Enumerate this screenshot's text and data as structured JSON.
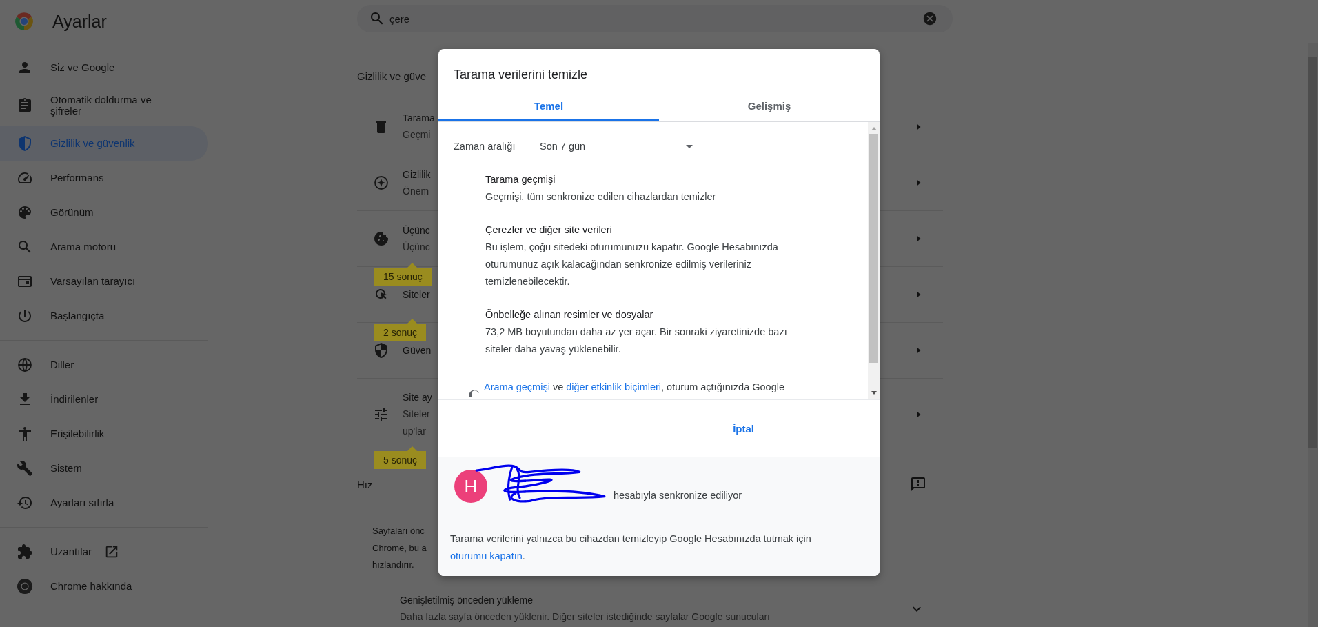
{
  "header": {
    "title": "Ayarlar",
    "search": {
      "value": "çere"
    }
  },
  "sidebar": {
    "sections": [
      {
        "items": [
          {
            "label": "Siz ve Google",
            "selected": false,
            "external": false
          },
          {
            "label": "Otomatik doldurma ve şifreler",
            "selected": false,
            "external": false
          },
          {
            "label": "Gizlilik ve güvenlik",
            "selected": true,
            "external": false
          },
          {
            "label": "Performans",
            "selected": false,
            "external": false
          },
          {
            "label": "Görünüm",
            "selected": false,
            "external": false
          },
          {
            "label": "Arama motoru",
            "selected": false,
            "external": false
          },
          {
            "label": "Varsayılan tarayıcı",
            "selected": false,
            "external": false
          },
          {
            "label": "Başlangıçta",
            "selected": false,
            "external": false
          }
        ]
      },
      {
        "items": [
          {
            "label": "Diller",
            "selected": false,
            "external": false
          },
          {
            "label": "İndirilenler",
            "selected": false,
            "external": false
          },
          {
            "label": "Erişilebilirlik",
            "selected": false,
            "external": false
          },
          {
            "label": "Sistem",
            "selected": false,
            "external": false
          },
          {
            "label": "Ayarları sıfırla",
            "selected": false,
            "external": false
          }
        ]
      },
      {
        "items": [
          {
            "label": "Uzantılar",
            "selected": false,
            "external": true
          },
          {
            "label": "Chrome hakkında",
            "selected": false,
            "external": false
          }
        ]
      }
    ]
  },
  "privacy": {
    "heading": "Gizlilik ve güve",
    "rows": [
      {
        "lines": [
          "Tarama",
          "Geçmi"
        ]
      },
      {
        "lines": [
          "Gizlilik",
          "Önem"
        ]
      },
      {
        "lines": [
          "Üçünc",
          "Üçünc"
        ],
        "badge": "15 sonuç"
      },
      {
        "lines": [
          "Siteler"
        ],
        "badge": "2 sonuç"
      },
      {
        "lines": [
          "Güven"
        ]
      },
      {
        "lines": [
          "Site ay",
          "Siteler",
          "up'lar"
        ],
        "badge": "5 sonuç"
      }
    ]
  },
  "speed": {
    "heading": "Hız",
    "rows": [
      {
        "kind": "setting",
        "lines": [
          "Sayfaları önc",
          "Chrome, bu a",
          "hızlandırır."
        ],
        "expandable": false
      },
      {
        "kind": "option",
        "lines": [
          "Genişletilmiş önceden yükleme",
          "Daha fazla sayfa önceden yüklenir. Diğer siteler istediğinde sayfalar Google sunucuları"
        ],
        "expandable": true
      }
    ]
  },
  "dialog": {
    "title": "Tarama verilerini temizle",
    "tabs": [
      {
        "label": "Temel",
        "selected": true
      },
      {
        "label": "Gelişmiş",
        "selected": false
      }
    ],
    "time_range": {
      "label": "Zaman aralığı",
      "value": "Son 7 gün"
    },
    "items": [
      {
        "title": "Tarama geçmişi",
        "description": "Geçmişi, tüm senkronize edilen cihazlardan temizler"
      },
      {
        "title": "Çerezler ve diğer site verileri",
        "description": "Bu işlem, çoğu sitedeki oturumunuzu kapatır. Google Hesabınızda oturumunuz açık kalacağından senkronize edilmiş verileriniz temizlenebilecektir."
      },
      {
        "title": "Önbelleğe alınan resimler ve dosyalar",
        "description": "73,2 MB boyutundan daha az yer açar. Bir sonraki ziyaretinizde bazı siteler daha yavaş yüklenebilir."
      }
    ],
    "notice": [
      {
        "text": "Arama geçmişi",
        "link": true
      },
      {
        "text": " ve ",
        "link": false
      },
      {
        "text": "diğer etkinlik biçimleri",
        "link": true
      },
      {
        "text": ", oturum açtığınızda Google",
        "link": false
      }
    ],
    "cancel": "İptal",
    "account": {
      "initial": "H",
      "sync_text": "hesabıyla senkronize ediliyor"
    },
    "signout_note": [
      {
        "text": "Tarama verilerini yalnızca bu cihazdan temizleyip Google Hesabınızda tutmak için ",
        "link": false
      },
      {
        "text": "oturumu kapatın",
        "link": true
      },
      {
        "text": ".",
        "link": false
      }
    ]
  }
}
